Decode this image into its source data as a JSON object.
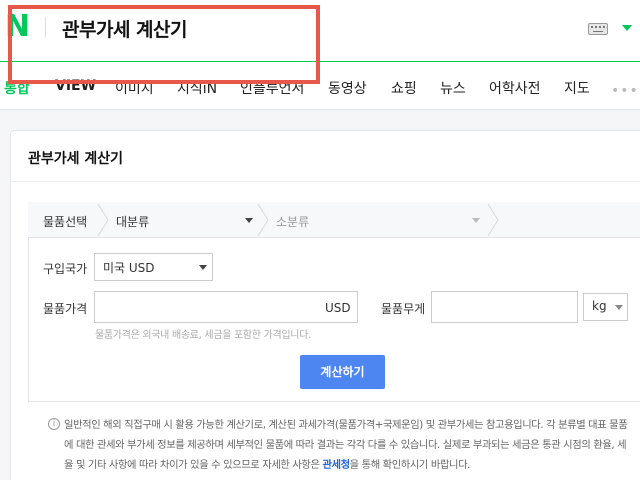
{
  "header": {
    "logo": "N",
    "query": "관부가세 계산기"
  },
  "tabs": [
    {
      "label": "통합"
    },
    {
      "label": "VIEW"
    },
    {
      "label": "이미지"
    },
    {
      "label": "지식iN"
    },
    {
      "label": "인플루언서"
    },
    {
      "label": "동영상"
    },
    {
      "label": "쇼핑"
    },
    {
      "label": "뉴스"
    },
    {
      "label": "어학사전"
    },
    {
      "label": "지도"
    }
  ],
  "more": "•••",
  "card": {
    "title": "관부가세 계산기",
    "crumb": {
      "label": "물품선택",
      "category_major": "대분류",
      "category_minor": "소분류"
    },
    "country": {
      "label": "구입국가",
      "value": "미국 USD"
    },
    "price": {
      "label": "물품가격",
      "unit": "USD",
      "value": "",
      "hint": "물품가격은 외국내 배송료, 세금을 포함한 가격입니다."
    },
    "weight": {
      "label": "물품무게",
      "value": "",
      "unit": "kg"
    },
    "calc_button": "계산하기",
    "notice": {
      "text_1": "일반적인 해외 직접구매 시 활용 가능한 계산기로, 계산된 과세가격(물품가격+국제운임) 및 관부가세는 참고용입니다. 각 분류별 대표 물품에 대한 관세와 부가세 정보를 제공하며 세부적인 물품에 따라 결과는 각각 다를 수 있습니다. 실제로 부과되는 세금은 통관 시점의 환율, 세율 및 기타 사항에 따라 차이가 있을 수 있으므로 자세한 사항은 ",
      "link": "관세청",
      "text_2": "을 통해 확인하시기 바랍니다."
    }
  },
  "colors": {
    "brand": "#03c75a",
    "button": "#4d86f0",
    "highlight": "#e8584a",
    "link": "#1f64d6"
  }
}
